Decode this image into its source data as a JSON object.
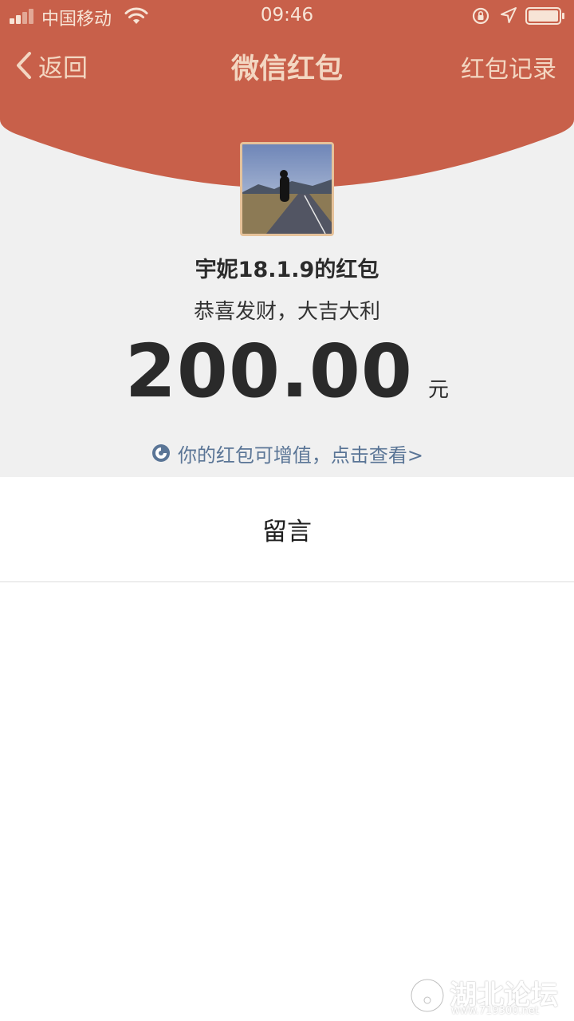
{
  "status_bar": {
    "carrier": "中国移动",
    "time": "09:46"
  },
  "nav": {
    "back_label": "返回",
    "title": "微信红包",
    "record_label": "红包记录"
  },
  "packet": {
    "sender_title": "宇妮18.1.9的红包",
    "wish": "恭喜发财，大吉大利",
    "amount": "200.00",
    "unit": "元",
    "value_link": "你的红包可增值，点击查看>"
  },
  "message": {
    "label": "留言"
  },
  "watermark": {
    "text": "湖北论坛",
    "url": "www.719300.net"
  },
  "colors": {
    "header_red": "#c8604a",
    "header_text": "#f3d7c2",
    "background_gray": "#f0f0f0",
    "link_blue": "#5a7596"
  }
}
